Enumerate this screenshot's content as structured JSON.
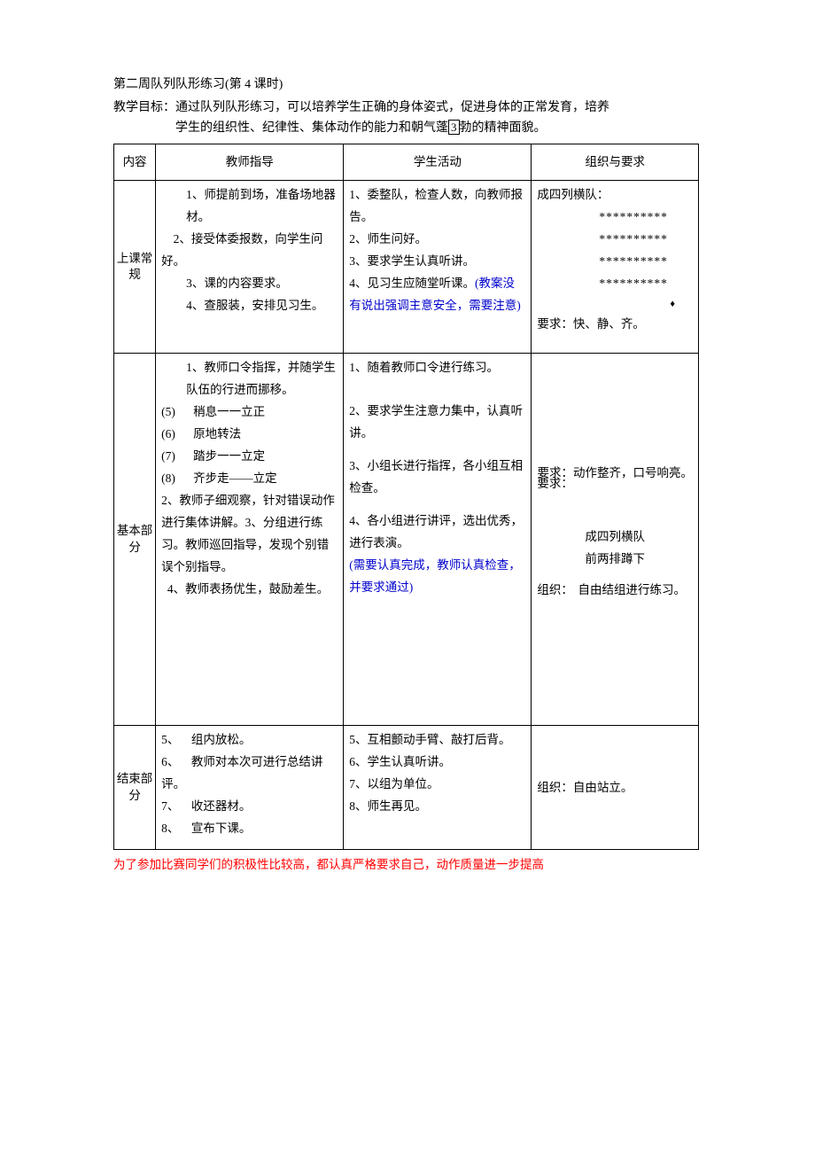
{
  "header": {
    "title": "第二周队列队形练习(第 4 课时)",
    "goal_label": "教学目标：",
    "goal_line1": "通过队列队形练习，可以培养学生正确的身体姿式，促进身体的正常发育，培养",
    "goal_line2_pre": "学生的组织性、纪律性、集体动作的能力和朝气蓬",
    "goal_box": "3",
    "goal_line2_post": "勃的精神面貌。"
  },
  "table": {
    "headers": {
      "section": "内容",
      "teacher": "教师指导",
      "student": "学生活动",
      "org": "组织与要求"
    },
    "routine": {
      "label": "上课常规",
      "teacher": [
        "1、师提前到场，准备场地器材。",
        "    2、接受体委报数，向学生问好。",
        "3、课的内容要求。",
        "4、查服装，安排见习生。"
      ],
      "student_items": [
        "1、委整队，检查人数，向教师报告。",
        "2、师生问好。",
        "",
        "3、要求学生认真听讲。",
        "4、见习生应随堂听课。"
      ],
      "student_blue": "(教案没有说出强调主意安全，需要注意)",
      "org": {
        "line1": "成四列横队：",
        "stars": "**********",
        "req": "要求：快、静、齐。"
      }
    },
    "basic": {
      "label": "基本部分",
      "teacher": {
        "item1": "1、教师口令指挥，并随学生队伍的行进而挪移。",
        "sub5": "(5)      稍息一一立正",
        "sub6": "(6)      原地转法",
        "sub7": "(7)      踏步一一立定",
        "sub8": "(8)      齐步走——立定",
        "item2": "2、教师子细观察，针对错误动作进行集体讲解。3、分组进行练习。教师巡回指导，发现个别错误个别指导。",
        "item4": "  4、教师表扬优生，鼓励差生。"
      },
      "student": {
        "item1": "1、随着教师口令进行练习。",
        "item2": "2、要求学生注意力集中，认真听讲。",
        "item3": "3、小组长进行指挥，各小组互相检查。",
        "item4": "4、各小组进行讲评，选出优秀，进行表演。",
        "blue": "(需要认真完成，教师认真检查，并要求通过)"
      },
      "org": {
        "req_line": "要求：动作整齐，口号响亮。",
        "org_label": "组织：",
        "org_l1": "成四列横队",
        "org_l2": "前两排蹲下",
        "org_l3": "自由结组进行练习。"
      }
    },
    "end": {
      "label": "结束部分",
      "teacher": [
        "5、    组内放松。",
        "6、    教师对本次可进行总结讲评。",
        "7、    收还器材。",
        "8、    宣布下课。"
      ],
      "student": [
        "5、互相颤动手臂、敲打后背。",
        "6、学生认真听讲。",
        "7、以组为单位。",
        "8、师生再见。"
      ],
      "org": "组织：自由站立。"
    }
  },
  "footer": "为了参加比赛同学们的积极性比较高，都认真严格要求自己，动作质量进一步提高"
}
